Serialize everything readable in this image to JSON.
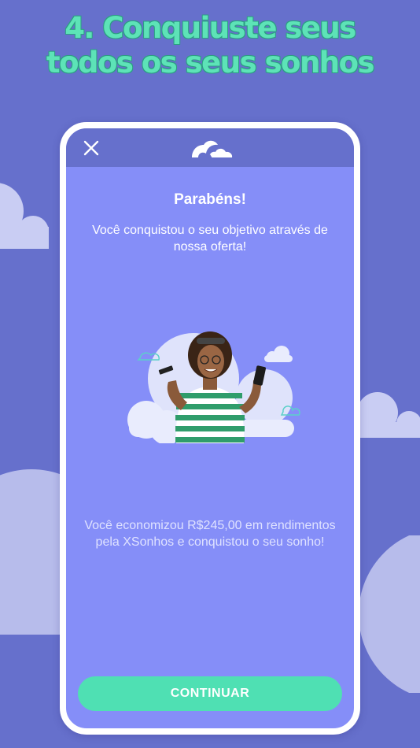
{
  "headline": {
    "line1": "4. Conquiuste seus",
    "line2": "todos os seus sonhos"
  },
  "colors": {
    "background": "#6670cc",
    "phone_screen": "#858ef8",
    "accent": "#4fe0b3",
    "headline": "#5de3b7"
  },
  "app": {
    "header": {
      "close_icon": "close-icon",
      "logo_icon": "cloud-logo-icon"
    },
    "title": "Parabéns!",
    "subtitle": "Você conquistou o seu objetivo através de nossa oferta!",
    "illustration": "woman-with-card-and-phone-on-clouds",
    "savings_text": "Você economizou R$245,00 em rendimentos pela XSonhos e conquistou o seu sonho!",
    "continue_label": "CONTINUAR"
  }
}
